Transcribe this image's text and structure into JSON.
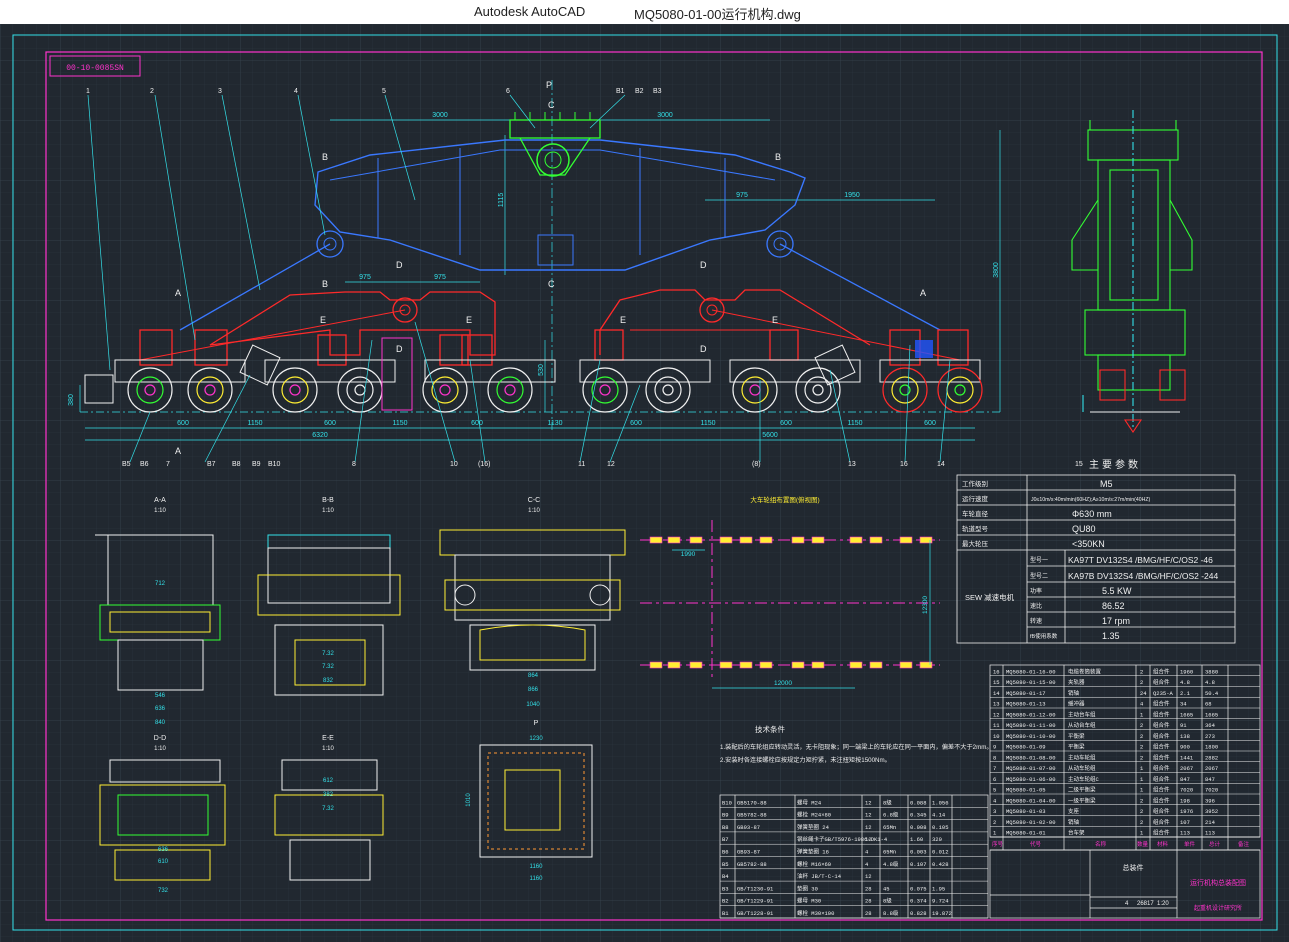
{
  "window": {
    "app_title": "Autodesk AutoCAD",
    "file_name": "MQ5080-01-00运行机构.dwg"
  },
  "drawing": {
    "drawing_code": "00-10-0085SN",
    "dims_top": [
      "3000",
      "3000",
      "975",
      "1950",
      "975",
      "975",
      "1115",
      "3800",
      "530",
      "380"
    ],
    "dims_bottom": [
      "600",
      "1150",
      "600",
      "1150",
      "600",
      "1130",
      "600",
      "1150",
      "600",
      "1150",
      "600"
    ],
    "dims_total": [
      "6320",
      "5600"
    ],
    "leaders_top": [
      "1",
      "2",
      "3",
      "4",
      "5",
      "6",
      "B1",
      "B2",
      "B3"
    ],
    "leaders_bottom": [
      "B5",
      "B6",
      "7",
      "B7",
      "B8",
      "B9",
      "B10",
      "8",
      "10",
      "(16)",
      "11",
      "12",
      "(8)",
      "13",
      "16",
      "14",
      "15"
    ],
    "section_marks": [
      "A",
      "B",
      "C",
      "D",
      "E",
      "P"
    ],
    "section_views": [
      {
        "title": "A-A",
        "scale": "1:10",
        "dims": [
          "712",
          "546",
          "636",
          "840"
        ]
      },
      {
        "title": "B-B",
        "scale": "1:10",
        "dims": [
          "7.32",
          "7.32",
          "832"
        ]
      },
      {
        "title": "C-C",
        "scale": "1:10",
        "dims": [
          "864",
          "866",
          "1040"
        ]
      },
      {
        "title": "D-D",
        "scale": "1:10",
        "dims": [
          "636",
          "610",
          "732"
        ]
      },
      {
        "title": "E-E",
        "scale": "1:10",
        "dims": [
          "612",
          "382",
          "7.32"
        ]
      },
      {
        "title": "P",
        "scale": "",
        "dims": [
          "1230",
          "1010",
          "1160",
          "1160"
        ]
      }
    ],
    "layout_plan": {
      "title": "大车轮组布置图(俯视图)",
      "dims": [
        "1990",
        "12000",
        "12300"
      ]
    },
    "tech_requirements": {
      "title": "技术条件",
      "lines": [
        "1.装配后的车轮组应转动灵活，无卡阻现象；同一端梁上的车轮应在同一平面内，偏差不大于2mm。",
        "2.安装时各连接螺栓应按规定力矩拧紧，未注扭矩按1500Nm。"
      ]
    },
    "main_params": {
      "title": "主要参数",
      "rows": [
        {
          "label": "工作级别",
          "value": "M5"
        },
        {
          "label": "运行速度",
          "value": "J0≤10m/s:40m/min(60HZ);A≥10m/s:27m/min(40HZ)"
        },
        {
          "label": "车轮直径",
          "value": "Φ630 mm"
        },
        {
          "label": "轨道型号",
          "value": "QU80"
        },
        {
          "label": "最大轮压",
          "value": "<350KN"
        }
      ],
      "sew_group_label": "SEW 减速电机",
      "sew_rows": [
        {
          "label": "型号一",
          "value": "KA97T DV132S4 /BMG/HF/C/OS2 -46"
        },
        {
          "label": "型号二",
          "value": "KA97B DV132S4 /BMG/HF/C/OS2 -244"
        },
        {
          "label": "功率",
          "value": "5.5 KW"
        },
        {
          "label": "速比",
          "value": "86.52"
        },
        {
          "label": "转速",
          "value": "17 rpm"
        },
        {
          "label": "fB使用系数",
          "value": "1.35"
        }
      ]
    },
    "parts_list": [
      {
        "no": "16",
        "code": "MQ5080-01-16-00",
        "name": "电缆卷筒装置",
        "qty": "2",
        "mat": "组合件",
        "w1": "1960",
        "w2": "3880"
      },
      {
        "no": "15",
        "code": "MQ5080-01-15-00",
        "name": "夹轨器",
        "qty": "2",
        "mat": "组合件",
        "w1": "4.8",
        "w2": "4.8"
      },
      {
        "no": "14",
        "code": "MQ5080-01-17",
        "name": "销轴",
        "qty": "24",
        "mat": "Q235-A",
        "w1": "2.1",
        "w2": "50.4"
      },
      {
        "no": "13",
        "code": "MQ5080-01-13",
        "name": "缓冲器",
        "qty": "4",
        "mat": "组合件",
        "w1": "34",
        "w2": "68"
      },
      {
        "no": "12",
        "code": "MQ5080-01-12-00",
        "name": "主动台车组",
        "qty": "1",
        "mat": "组合件",
        "w1": "1665",
        "w2": "1665"
      },
      {
        "no": "11",
        "code": "MQ5080-01-11-00",
        "name": "从动台车组",
        "qty": "2",
        "mat": "组合件",
        "w1": "91",
        "w2": "364"
      },
      {
        "no": "10",
        "code": "MQ5080-01-10-00",
        "name": "平衡梁",
        "qty": "2",
        "mat": "组合件",
        "w1": "138",
        "w2": "273"
      },
      {
        "no": "9",
        "code": "MQ5080-01-09",
        "name": "平衡梁",
        "qty": "2",
        "mat": "组合件",
        "w1": "900",
        "w2": "1800"
      },
      {
        "no": "8",
        "code": "MQ5080-01-08-00",
        "name": "主动车轮组",
        "qty": "2",
        "mat": "组合件",
        "w1": "1441",
        "w2": "2882"
      },
      {
        "no": "7",
        "code": "MQ5080-01-07-00",
        "name": "从动车轮组",
        "qty": "1",
        "mat": "组合件",
        "w1": "2067",
        "w2": "2067"
      },
      {
        "no": "6",
        "code": "MQ5080-01-06-00",
        "name": "主动车轮组C",
        "qty": "1",
        "mat": "组合件",
        "w1": "847",
        "w2": "847"
      },
      {
        "no": "5",
        "code": "MQ5080-01-05",
        "name": "二级平衡梁",
        "qty": "1",
        "mat": "组合件",
        "w1": "7020",
        "w2": "7020"
      },
      {
        "no": "4",
        "code": "MQ5080-01-04-00",
        "name": "一级平衡梁",
        "qty": "2",
        "mat": "组合件",
        "w1": "198",
        "w2": "396"
      },
      {
        "no": "3",
        "code": "MQ5080-01-03",
        "name": "支座",
        "qty": "2",
        "mat": "组合件",
        "w1": "1976",
        "w2": "3952"
      },
      {
        "no": "2",
        "code": "MQ5080-01-02-00",
        "name": "销轴",
        "qty": "2",
        "mat": "组合件",
        "w1": "107",
        "w2": "214"
      },
      {
        "no": "1",
        "code": "MQ5080-01-01",
        "name": "台车架",
        "qty": "1",
        "mat": "组合件",
        "w1": "113",
        "w2": "113"
      }
    ],
    "parts_header": [
      "序号",
      "代号",
      "名称",
      "数量",
      "材料",
      "单件",
      "总计",
      "备注"
    ],
    "std_parts": [
      {
        "no": "B10",
        "code": "GB5170-88",
        "name": "螺母 M24",
        "qty": "12",
        "mat": "8级",
        "w1": "0.088",
        "w2": "1.056"
      },
      {
        "no": "B9",
        "code": "GB5782-88",
        "name": "螺栓 M24×80",
        "qty": "12",
        "mat": "6.8级",
        "w1": "0.345",
        "w2": "4.14"
      },
      {
        "no": "B8",
        "code": "GB93-87",
        "name": "弹簧垫圈 24",
        "qty": "12",
        "mat": "65Mn",
        "w1": "0.008",
        "w2": "0.105"
      },
      {
        "no": "B7",
        "code": "",
        "name": "钢丝绳卡子GB/T5976-1986-DK1-4",
        "qty": "12",
        "mat": "",
        "w1": "1.60",
        "w2": "320"
      },
      {
        "no": "B6",
        "code": "GB93-87",
        "name": "弹簧垫圈 16",
        "qty": "4",
        "mat": "65Mn",
        "w1": "0.003",
        "w2": "0.012"
      },
      {
        "no": "B5",
        "code": "GB5782-88",
        "name": "螺栓 M16×60",
        "qty": "4",
        "mat": "4.8级",
        "w1": "0.107",
        "w2": "0.428"
      },
      {
        "no": "B4",
        "code": "",
        "name": "油杯 JB/T-C-14",
        "qty": "12",
        "mat": "",
        "w1": "",
        "w2": ""
      },
      {
        "no": "B3",
        "code": "GB/T1230-91",
        "name": "垫圈 30",
        "qty": "28",
        "mat": "45",
        "w1": "0.075",
        "w2": "1.95"
      },
      {
        "no": "B2",
        "code": "GB/T1229-91",
        "name": "螺母 M30",
        "qty": "28",
        "mat": "8级",
        "w1": "0.374",
        "w2": "9.724"
      },
      {
        "no": "B1",
        "code": "GB/T1228-91",
        "name": "螺栓 M30×100",
        "qty": "28",
        "mat": "8.8级",
        "w1": "0.828",
        "w2": "19.872"
      }
    ],
    "title_block": {
      "assembly": "总装件",
      "title": "运行机构总装配图",
      "company": "起重机设计研究所",
      "weight": "26817",
      "scale": "1:20",
      "sheet": "4"
    }
  },
  "colors": {
    "background": "#212830",
    "border_magenta": "#ff33cc",
    "cyan": "#33e0e8",
    "blue_beam": "#3a78ff",
    "red_beam": "#ff2a2a",
    "green_frame": "#33ff33",
    "white_wheel": "#f0f0f0",
    "yellow": "#ffee33"
  }
}
